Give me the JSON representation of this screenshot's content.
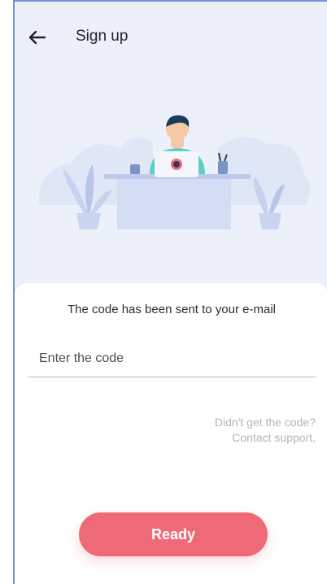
{
  "header": {
    "title": "Sign up",
    "back_icon": "arrow-left-icon"
  },
  "illustration": {
    "icon": "person-at-desk-illustration"
  },
  "form": {
    "info_text": "The code has been sent to your e-mail",
    "code_placeholder": "Enter the code",
    "code_value": "",
    "support_line1": "Didn't get the code?",
    "support_line2": "Contact support."
  },
  "actions": {
    "ready_label": "Ready"
  },
  "colors": {
    "accent": "#ef6a78",
    "background": "#ebf0fb",
    "muted_text": "#b2b5bd"
  }
}
